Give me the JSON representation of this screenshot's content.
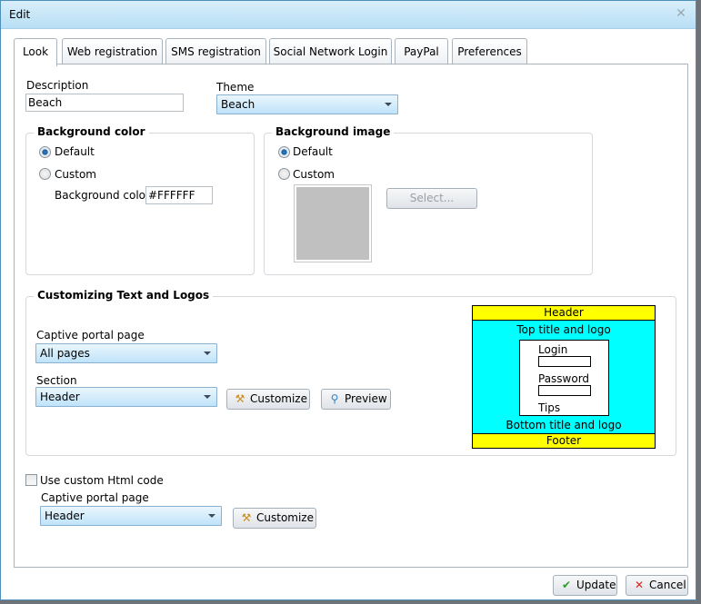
{
  "window": {
    "title": "Edit",
    "close_icon": "close-icon"
  },
  "tabs": [
    {
      "label": "Look",
      "active": true
    },
    {
      "label": "Web registration",
      "active": false
    },
    {
      "label": "SMS registration",
      "active": false
    },
    {
      "label": "Social Network Login",
      "active": false
    },
    {
      "label": "PayPal",
      "active": false
    },
    {
      "label": "Preferences",
      "active": false
    }
  ],
  "look": {
    "description_label": "Description",
    "description_value": "Beach",
    "theme_label": "Theme",
    "theme_value": "Beach",
    "background_color": {
      "title": "Background color",
      "default_label": "Default",
      "custom_label": "Custom",
      "selected": "Default",
      "color_label": "Background color",
      "color_value": "#FFFFFF"
    },
    "background_image": {
      "title": "Background image",
      "default_label": "Default",
      "custom_label": "Custom",
      "selected": "Default",
      "select_button": "Select..."
    },
    "customizing": {
      "title": "Customizing Text and Logos",
      "page_label": "Captive portal page",
      "page_value": "All pages",
      "section_label": "Section",
      "section_value": "Header",
      "customize_button": "Customize",
      "preview_button": "Preview",
      "layout_preview": {
        "header": "Header",
        "top": "Top title and logo",
        "login": "Login",
        "password": "Password",
        "tips": "Tips",
        "bottom": "Bottom title and logo",
        "footer": "Footer",
        "colors": {
          "band": "#FFFF00",
          "body": "#00FFFF"
        }
      }
    },
    "custom_html": {
      "checkbox_label": "Use custom Html code",
      "checked": false,
      "page_label": "Captive portal page",
      "page_value": "Header",
      "customize_button": "Customize"
    }
  },
  "footer": {
    "update_button": "Update",
    "cancel_button": "Cancel"
  }
}
